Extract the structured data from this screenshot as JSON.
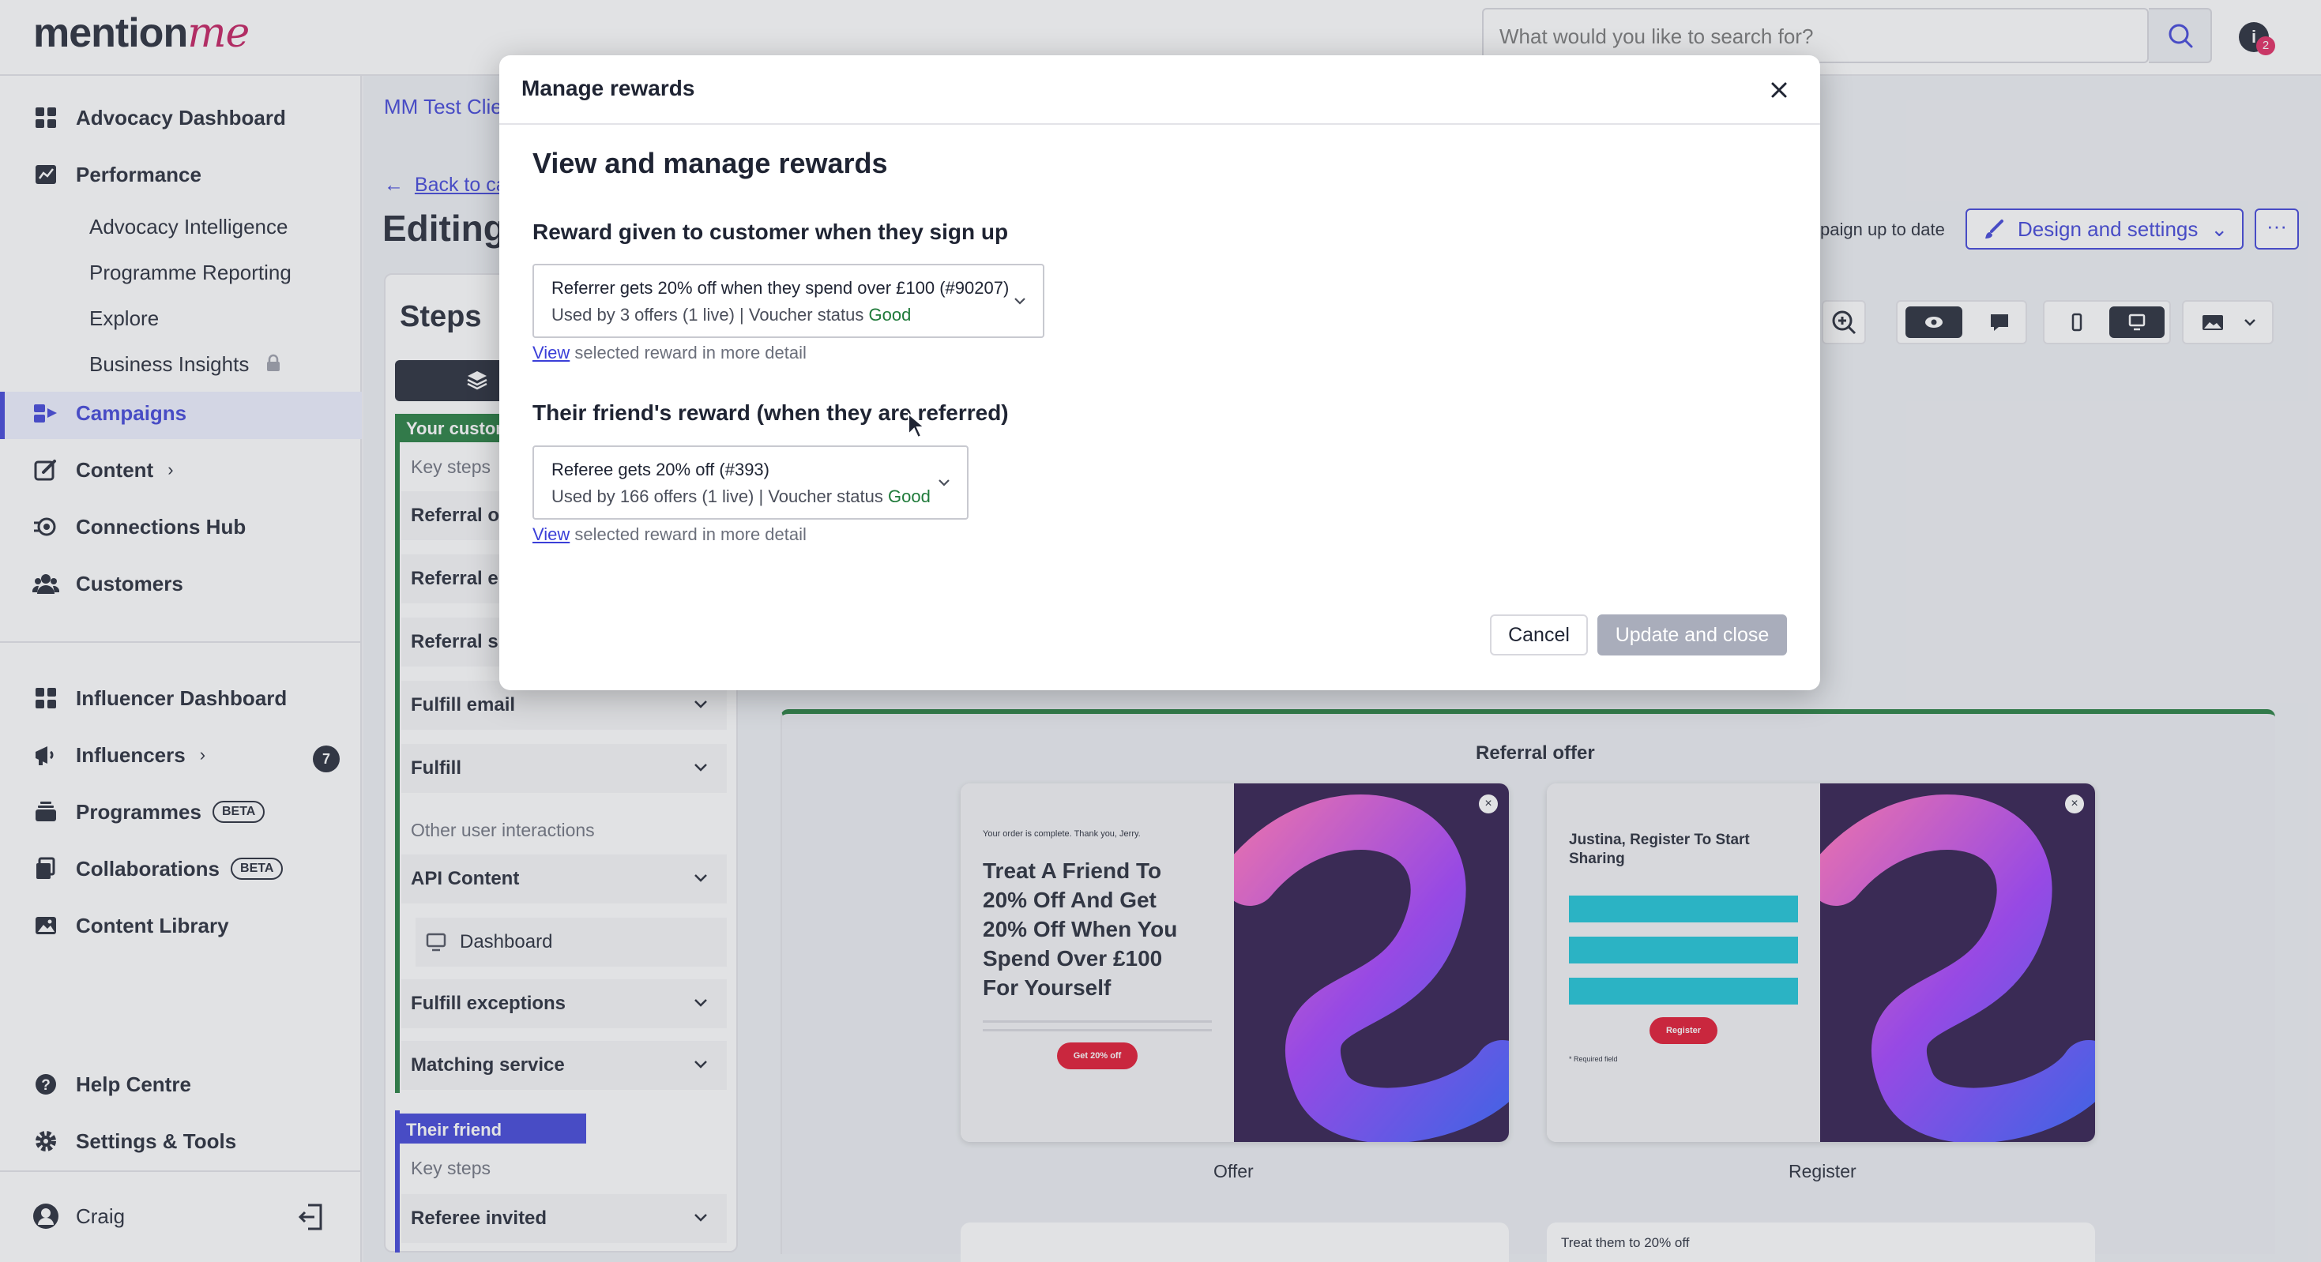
{
  "topbar": {
    "logo_main": "mention",
    "logo_accent": "me",
    "search_placeholder": "What would you like to search for?",
    "avatar_initial": "i",
    "notification_count": "2"
  },
  "sidebar": {
    "advocacy_dashboard": "Advocacy Dashboard",
    "performance": "Performance",
    "performance_sub": [
      "Advocacy Intelligence",
      "Programme Reporting",
      "Explore",
      "Business Insights"
    ],
    "campaigns": "Campaigns",
    "content": "Content",
    "connections_hub": "Connections Hub",
    "customers": "Customers",
    "influencer_dashboard": "Influencer Dashboard",
    "influencers": "Influencers",
    "influencers_count": "7",
    "programmes": "Programmes",
    "collaborations": "Collaborations",
    "beta": "BETA",
    "content_library": "Content Library",
    "help_centre": "Help Centre",
    "settings_tools": "Settings & Tools",
    "user_name": "Craig"
  },
  "background": {
    "breadcrumb": "MM Test Clie",
    "back_link": "Back to ca",
    "editing_title": "Editing:",
    "up_to_date": "paign up to date",
    "design_settings": "Design and settings",
    "more": "···",
    "steps_title": "Steps",
    "your_customer": "Your custom",
    "key_steps": "Key steps",
    "steps": [
      "Referral off",
      "Referral em",
      "Referral sha",
      "Fulfill email",
      "Fulfill"
    ],
    "other_interactions": "Other user interactions",
    "api_content": "API Content",
    "dashboard": "Dashboard",
    "fulfill_exceptions": "Fulfill exceptions",
    "matching_service": "Matching service",
    "their_friend": "Their friend (Referee)",
    "key_steps_2": "Key steps",
    "referee_invited": "Referee invited",
    "preview_title": "Referral offer",
    "offer_card": {
      "small": "Your order is complete. Thank you, Jerry.",
      "headline": "Treat A Friend To 20% Off And Get 20% Off When You Spend Over £100 For Yourself",
      "cta": "Get 20% off",
      "caption": "Offer"
    },
    "register_card": {
      "headline": "Justina, Register To Start Sharing",
      "cta": "Register",
      "required": "* Required field",
      "caption": "Register"
    },
    "bottom_card_text": "Treat them to 20% off"
  },
  "modal": {
    "title": "Manage rewards",
    "heading": "View and manage rewards",
    "section1_title": "Reward given to customer when they sign up",
    "reward1_line1": "Referrer gets 20% off when they spend over £100 (#90207)",
    "reward1_line2": "Used by 3 offers (1 live) | Voucher status ",
    "reward1_status": "Good",
    "section2_title": "Their friend's reward (when they are referred)",
    "reward2_line1": "Referee gets 20% off (#393)",
    "reward2_line2": "Used by 166 offers (1 live) | Voucher status ",
    "reward2_status": "Good",
    "view_link": "View",
    "view_suffix": " selected reward in more detail",
    "cancel": "Cancel",
    "update": "Update and close"
  },
  "colors": {
    "brand_pink": "#c2185b",
    "accent_blue": "#3b3fd8",
    "status_green": "#1f7a3a",
    "disabled_button": "#a9adbb"
  }
}
